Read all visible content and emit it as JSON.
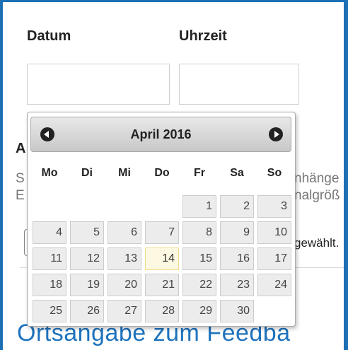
{
  "form": {
    "date_label": "Datum",
    "time_label": "Uhrzeit"
  },
  "background": {
    "partial_letter_a": "A",
    "partial_letter_s": "S",
    "partial_letter_b": "E",
    "line1_right": "nhänge",
    "line2_right": "nalgröß",
    "line3_right": "gewählt.",
    "heading": "Ortsangabe zum Feedba"
  },
  "datepicker": {
    "month_title": "April 2016",
    "prev_icon": "chevron-left-circle-icon",
    "next_icon": "chevron-right-circle-icon",
    "weekdays": [
      "Mo",
      "Di",
      "Mi",
      "Do",
      "Fr",
      "Sa",
      "So"
    ],
    "weeks": [
      [
        "",
        "",
        "",
        "",
        "1",
        "2",
        "3"
      ],
      [
        "4",
        "5",
        "6",
        "7",
        "8",
        "9",
        "10"
      ],
      [
        "11",
        "12",
        "13",
        "14",
        "15",
        "16",
        "17"
      ],
      [
        "18",
        "19",
        "20",
        "21",
        "22",
        "23",
        "24"
      ],
      [
        "25",
        "26",
        "27",
        "28",
        "29",
        "30",
        ""
      ]
    ],
    "today": "14",
    "today_color": "#fdf8e1"
  },
  "colors": {
    "accent": "#1d6fb5",
    "heading_link": "#1e73be"
  }
}
